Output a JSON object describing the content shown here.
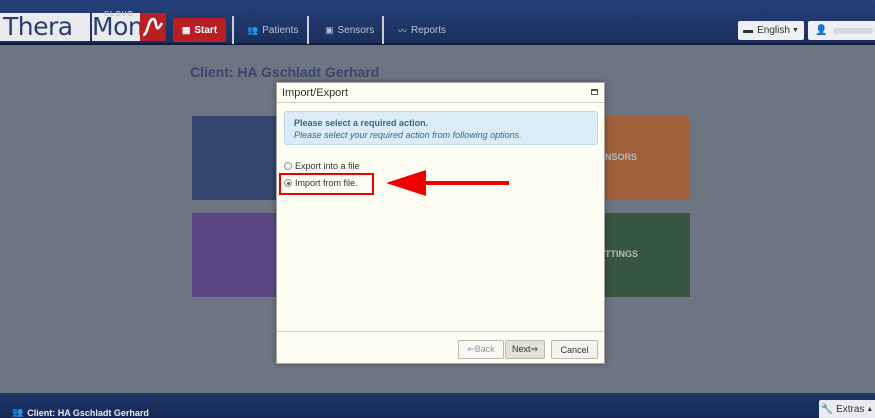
{
  "app": {
    "logo_thera": "Thera",
    "logo_mon": "Mon",
    "logo_cloud": "CLOUD"
  },
  "nav": {
    "start": "Start",
    "patients": "Patients",
    "sensors": "Sensors",
    "reports": "Reports"
  },
  "header": {
    "language": "English",
    "user_icon": "user-icon"
  },
  "main": {
    "client_title": "Client: HA Gschladt Gerhard",
    "tiles": [
      {
        "label": ""
      },
      {
        "label": "NSORS"
      },
      {
        "label": ""
      },
      {
        "label": "TTINGS"
      }
    ]
  },
  "modal": {
    "title": "Import/Export",
    "alert_title": "Please select a required action.",
    "alert_text": "Please select your required action from following options.",
    "options": [
      {
        "label": "Export into a file",
        "selected": false
      },
      {
        "label": "Import from file.",
        "selected": true
      }
    ],
    "buttons": {
      "back": "⇐Back",
      "next": "Next⇒",
      "cancel": "Cancel"
    }
  },
  "footer": {
    "client": "Client: HA Gschladt Gerhard",
    "extras": "Extras"
  },
  "colors": {
    "accent_red": "#b81f24",
    "navy": "#1c2f5c",
    "annotation_red": "#e00000"
  }
}
